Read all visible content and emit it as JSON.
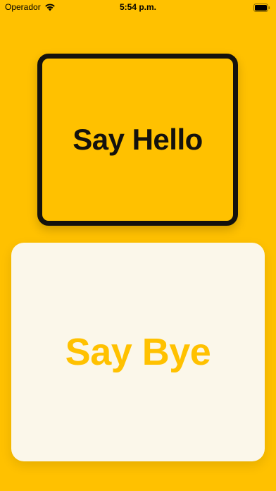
{
  "status_bar": {
    "carrier": "Operador",
    "time": "5:54 p.m.",
    "wifi_icon": "wifi-icon",
    "battery_icon": "battery-icon"
  },
  "hello_button": {
    "label": "Say Hello"
  },
  "bye_button": {
    "label": "Say Bye"
  },
  "colors": {
    "background": "#FFC100",
    "hello_border": "#14120D",
    "bye_card": "#FBF7EA",
    "bye_text": "#FFC100"
  }
}
